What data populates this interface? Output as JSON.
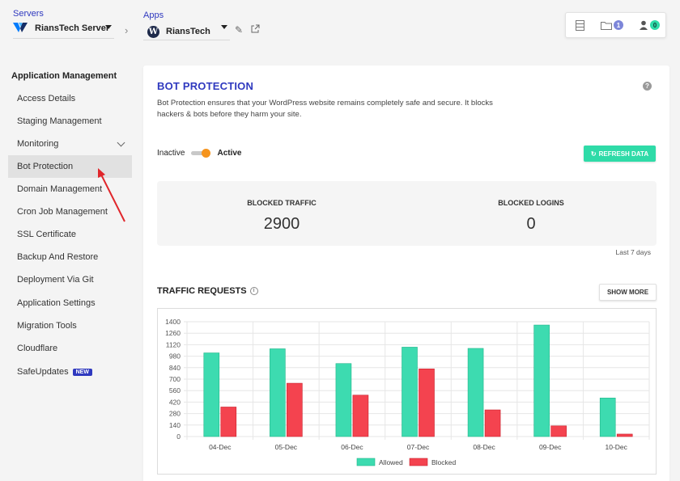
{
  "topbar": {
    "servers_label": "Servers",
    "server_name": "RiansTech Server",
    "apps_label": "Apps",
    "app_name": "RiansTech",
    "wp_glyph": "W",
    "folder_count": "1",
    "user_count": "0"
  },
  "sidebar": {
    "heading": "Application Management",
    "items": [
      {
        "label": "Access Details"
      },
      {
        "label": "Staging Management"
      },
      {
        "label": "Monitoring"
      },
      {
        "label": "Bot Protection"
      },
      {
        "label": "Domain Management"
      },
      {
        "label": "Cron Job Management"
      },
      {
        "label": "SSL Certificate"
      },
      {
        "label": "Backup And Restore"
      },
      {
        "label": "Deployment Via Git"
      },
      {
        "label": "Application Settings"
      },
      {
        "label": "Migration Tools"
      },
      {
        "label": "Cloudflare"
      },
      {
        "label": "SafeUpdates",
        "badge": "NEW"
      }
    ]
  },
  "bot_protection": {
    "title": "BOT PROTECTION",
    "description": "Bot Protection ensures that your WordPress website remains completely safe and secure. It blocks hackers & bots before they harm your site.",
    "toggle_inactive": "Inactive",
    "toggle_active": "Active",
    "toggle_state": "active",
    "refresh_button": "REFRESH DATA",
    "blocked_traffic_label": "BLOCKED TRAFFIC",
    "blocked_traffic_value": "2900",
    "blocked_logins_label": "BLOCKED LOGINS",
    "blocked_logins_value": "0",
    "period": "Last 7 days"
  },
  "traffic": {
    "title": "TRAFFIC REQUESTS",
    "show_more": "SHOW MORE"
  },
  "colors": {
    "allowed": "#3ddbb0",
    "blocked": "#f4434f",
    "accent": "#2f39bf"
  },
  "chart_data": {
    "type": "bar",
    "categories": [
      "04-Dec",
      "05-Dec",
      "06-Dec",
      "07-Dec",
      "08-Dec",
      "09-Dec",
      "10-Dec"
    ],
    "series": [
      {
        "name": "Allowed",
        "values": [
          1020,
          1070,
          890,
          1090,
          1075,
          1360,
          470
        ]
      },
      {
        "name": "Blocked",
        "values": [
          360,
          650,
          505,
          825,
          325,
          130,
          30
        ]
      }
    ],
    "yticks": [
      0,
      140,
      280,
      420,
      560,
      700,
      840,
      980,
      1120,
      1260,
      1400
    ],
    "ylim": [
      0,
      1400
    ],
    "grid": true,
    "legend": "bottom"
  }
}
